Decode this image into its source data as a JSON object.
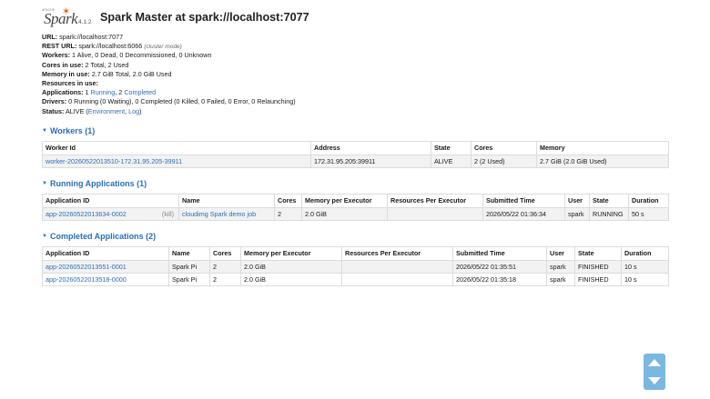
{
  "header": {
    "logo_apache": "APACHE",
    "logo_text": "Spark",
    "version": "4.1.2",
    "title": "Spark Master at spark://localhost:7077"
  },
  "summary": {
    "url_label": "URL:",
    "url_value": "spark://localhost:7077",
    "rest_label": "REST URL:",
    "rest_value": "spark://localhost:6066",
    "rest_note": "(cluster mode)",
    "workers_label": "Workers:",
    "workers_value": "1 Alive, 0 Dead, 0 Decommissioned, 0 Unknown",
    "cores_label": "Cores in use:",
    "cores_value": "2 Total, 2 Used",
    "memory_label": "Memory in use:",
    "memory_value": "2.7 GiB Total, 2.0 GiB Used",
    "resources_label": "Resources in use:",
    "apps_label": "Applications:",
    "apps_running_count": "1",
    "apps_running_link": "Running",
    "apps_sep": ", 2",
    "apps_completed_link": "Completed",
    "drivers_label": "Drivers:",
    "drivers_value": "0 Running (0 Waiting), 0 Completed (0 Killed, 0 Failed, 0 Error, 0 Relaunching)",
    "status_label": "Status:",
    "status_value": "ALIVE (",
    "status_env_link": "Environment",
    "status_comma": ", ",
    "status_log_link": "Log",
    "status_close": ")"
  },
  "workers": {
    "title": "Workers (1)",
    "headers": [
      "Worker Id",
      "Address",
      "State",
      "Cores",
      "Memory"
    ],
    "rows": [
      {
        "id": "worker-20260522013510-172.31.95.205-39911",
        "address": "172.31.95.205:39911",
        "state": "ALIVE",
        "cores": "2 (2 Used)",
        "memory": "2.7 GiB (2.0 GiB Used)"
      }
    ]
  },
  "running": {
    "title": "Running Applications (1)",
    "headers": [
      "Application ID",
      "Name",
      "Cores",
      "Memory per Executor",
      "Resources Per Executor",
      "Submitted Time",
      "User",
      "State",
      "Duration"
    ],
    "rows": [
      {
        "id": "app-20260522013634-0002",
        "kill": "(kill)",
        "name": "cloudimg Spark demo job",
        "cores": "2",
        "memory": "2.0 GiB",
        "resources": "",
        "submitted": "2026/05/22 01:36:34",
        "user": "spark",
        "state": "RUNNING",
        "duration": "50 s"
      }
    ]
  },
  "completed": {
    "title": "Completed Applications (2)",
    "headers": [
      "Application ID",
      "Name",
      "Cores",
      "Memory per Executor",
      "Resources Per Executor",
      "Submitted Time",
      "User",
      "State",
      "Duration"
    ],
    "rows": [
      {
        "id": "app-20260522013551-0001",
        "name": "Spark Pi",
        "cores": "2",
        "memory": "2.0 GiB",
        "resources": "",
        "submitted": "2026/05/22 01:35:51",
        "user": "spark",
        "state": "FINISHED",
        "duration": "10 s"
      },
      {
        "id": "app-20260522013518-0000",
        "name": "Spark Pi",
        "cores": "2",
        "memory": "2.0 GiB",
        "resources": "",
        "submitted": "2026/05/22 01:35:18",
        "user": "spark",
        "state": "FINISHED",
        "duration": "10 s"
      }
    ]
  }
}
